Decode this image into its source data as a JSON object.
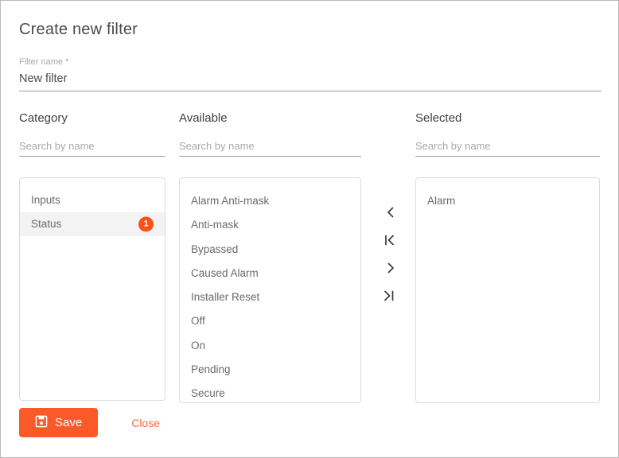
{
  "dialog": {
    "title": "Create new filter"
  },
  "filter_name": {
    "label": "Filter name *",
    "value": "New filter"
  },
  "columns": {
    "category": {
      "heading": "Category",
      "search_placeholder": "Search by name",
      "items": [
        {
          "label": "Inputs",
          "selected": false,
          "badge": ""
        },
        {
          "label": "Status",
          "selected": true,
          "badge": "1"
        }
      ]
    },
    "available": {
      "heading": "Available",
      "search_placeholder": "Search by name",
      "items": [
        {
          "label": "Alarm Anti-mask"
        },
        {
          "label": "Anti-mask"
        },
        {
          "label": "Bypassed"
        },
        {
          "label": "Caused Alarm"
        },
        {
          "label": "Installer Reset"
        },
        {
          "label": "Off"
        },
        {
          "label": "On"
        },
        {
          "label": "Pending"
        },
        {
          "label": "Secure"
        }
      ]
    },
    "selected": {
      "heading": "Selected",
      "search_placeholder": "Search by name",
      "items": [
        {
          "label": "Alarm"
        }
      ]
    }
  },
  "transfer_buttons": [
    {
      "icon": "chevron-left-icon",
      "title": "Move selected left"
    },
    {
      "icon": "chevron-left-bar-icon",
      "title": "Move all left"
    },
    {
      "icon": "chevron-right-icon",
      "title": "Move selected right"
    },
    {
      "icon": "chevron-right-bar-icon",
      "title": "Move all right"
    }
  ],
  "footer": {
    "save_label": "Save",
    "save_icon": "save-floppy-icon",
    "close_label": "Close"
  },
  "colors": {
    "accent": "#fa5a28",
    "badge": "#fa5218",
    "close_link": "#fa6a3c",
    "border": "#dcdcdc",
    "text": "#4a4a4a",
    "muted_text": "#a8a8a8"
  }
}
